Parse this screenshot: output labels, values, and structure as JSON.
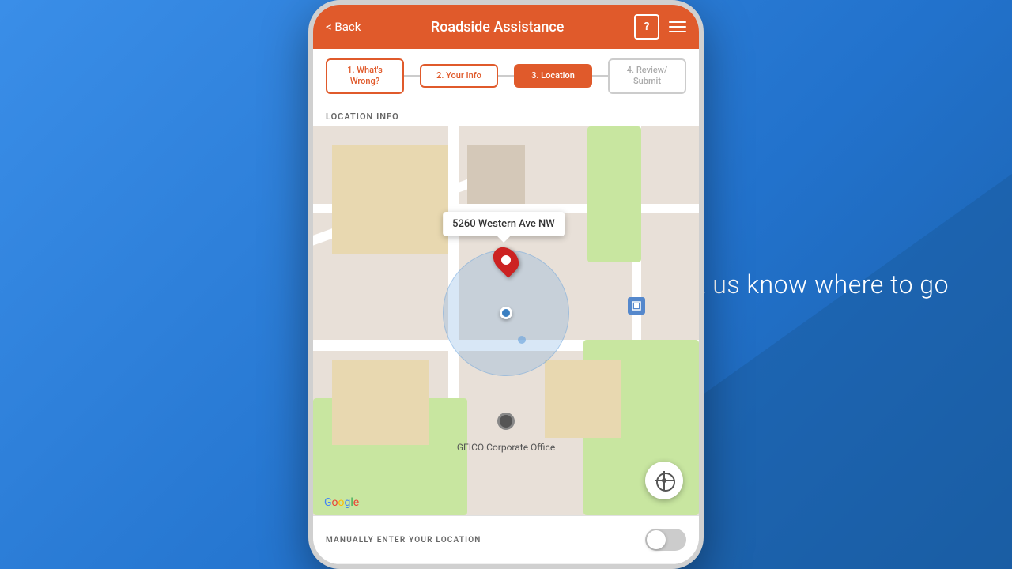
{
  "background": {
    "color": "#2d7dd2"
  },
  "side_text": "Let us know where to go",
  "app": {
    "header": {
      "back_label": "< Back",
      "title": "Roadside Assistance",
      "help_icon": "?",
      "menu_icon": "hamburger"
    },
    "steps": [
      {
        "id": 1,
        "label": "1. What's Wrong?",
        "state": "outline"
      },
      {
        "id": 2,
        "label": "2. Your Info",
        "state": "outline"
      },
      {
        "id": 3,
        "label": "3. Location",
        "state": "active"
      },
      {
        "id": 4,
        "label": "4. Review/ Submit",
        "state": "disabled"
      }
    ],
    "section_label": "LOCATION INFO",
    "map": {
      "address": "5260 Western Ave NW",
      "place_name": "GEICO Corporate Office",
      "google_label": "Google"
    },
    "bottom": {
      "manual_location_label": "MANUALLY ENTER YOUR LOCATION",
      "toggle_state": "off"
    }
  }
}
